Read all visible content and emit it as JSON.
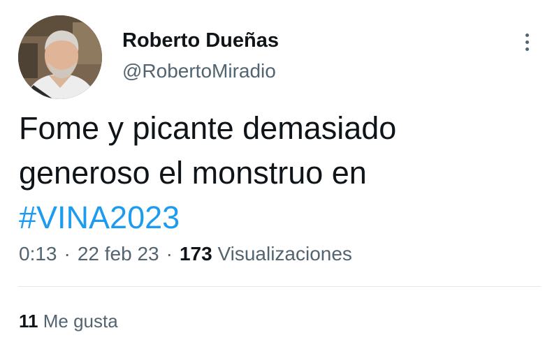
{
  "author": {
    "display_name": "Roberto Dueñas",
    "handle": "@RobertoMiradio"
  },
  "more_icon": "more-vertical-icon",
  "tweet": {
    "lines": [
      "Fome y picante demasiado",
      "generoso el monstruo en"
    ],
    "hashtag": "#VINA2023"
  },
  "meta": {
    "time": "0:13",
    "date": "22 feb 23",
    "separator": "·",
    "views_count": "173",
    "views_label": "Visualizaciones"
  },
  "engagement": {
    "likes_count": "11",
    "likes_label": "Me gusta"
  },
  "colors": {
    "link": "#1d9bf0",
    "secondary_text": "#536471",
    "primary_text": "#0f1419",
    "divider": "#e4e8ea"
  }
}
